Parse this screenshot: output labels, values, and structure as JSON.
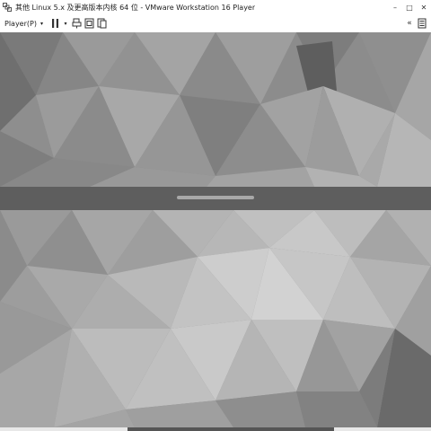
{
  "window": {
    "title": "其他 Linux 5.x 及更高版本内核 64 位 - VMware Workstation 16 Player",
    "app_icon": "vmware-player-icon",
    "controls": {
      "minimize": "–",
      "maximize": "□",
      "close": "✕"
    }
  },
  "toolbar": {
    "player_menu_label": "Player(P)",
    "player_menu_caret": "▾",
    "pause_caret": "▾",
    "icons": [
      "pause-icon",
      "send-ctrl-alt-del-icon",
      "fit-guest-icon",
      "unity-icon"
    ],
    "right_chevrons": "«",
    "right_icons": [
      "library-icon"
    ]
  },
  "colors": {
    "titlebar_bg": "#ffffff",
    "vm_bg": "#8a8a8a",
    "divider_band": "#5a5a5a",
    "drag_handle": "#a8a8a8"
  }
}
